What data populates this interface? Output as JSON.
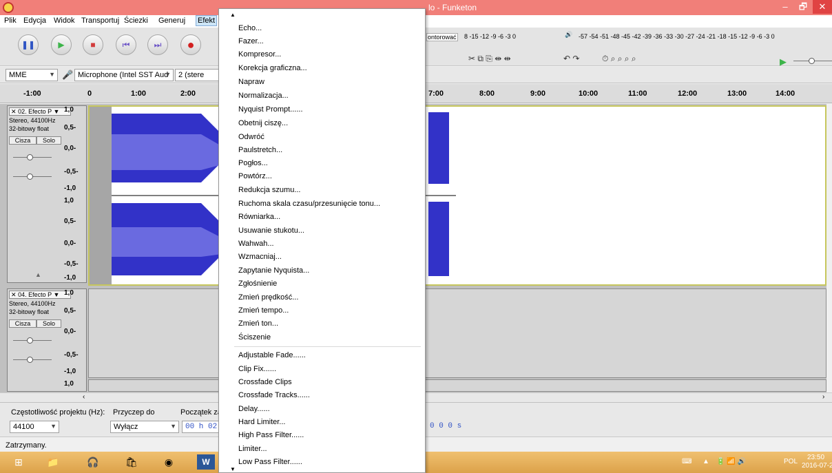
{
  "window": {
    "title": "lo - Funketon",
    "min_label": "–",
    "max_label": "🗗",
    "close_label": "✕"
  },
  "menubar": {
    "items": [
      "Plik",
      "Edycja",
      "Widok",
      "Transportuj",
      "Ściezki",
      "Generuj",
      "Efekt"
    ]
  },
  "toolbar": {
    "pause": "❚❚",
    "play": "▶",
    "stop": "■",
    "skip_start": "⏮",
    "skip_end": "⏭",
    "record": "●",
    "monitor_label": "ontorować",
    "rec_meter_scale": "8 -15 -12 -9 -6 -3 0",
    "play_meter_lr": "L\nP",
    "play_meter_scale": "-57 -54 -51 -48 -45 -42 -39 -36 -33 -30 -27 -24 -21 -18 -15 -12 -9 -6 -3 0",
    "edit_tools": "✂ ⧉ ⎘ ⇹ ⇹",
    "undo_redo": "↶ ↷",
    "zoom_tools": "⏱ ⌕ ⌕ ⌕ ⌕"
  },
  "devicebar": {
    "host": "MME",
    "input_device": "Microphone (Intel SST Aud",
    "channels": "2 (stere"
  },
  "ruler": {
    "ticks": [
      "-1:00",
      "0",
      "1:00",
      "2:00",
      "7:00",
      "8:00",
      "9:00",
      "10:00",
      "11:00",
      "12:00",
      "13:00",
      "14:00"
    ]
  },
  "tracks": [
    {
      "name": "02. Efecto P",
      "rate": "Stereo, 44100Hz",
      "format": "32-bitowy float",
      "mute": "Cisza",
      "solo": "Solo"
    },
    {
      "name": "04. Efecto P",
      "rate": "Stereo, 44100Hz",
      "format": "32-bitowy float",
      "mute": "Cisza",
      "solo": "Solo"
    }
  ],
  "scale": [
    "1,0",
    "0,5-",
    "0,0-",
    "-0,5-",
    "-1,0"
  ],
  "collapse_arrow": "▲",
  "bottombar": {
    "rate_label": "Częstotliwość projektu (Hz):",
    "rate_value": "44100",
    "snap_label": "Przyczep do",
    "snap_value": "Wyłącz",
    "start_label": "Początek za",
    "start_value": "00 h 02 r",
    "end_value": "0 0 0 s"
  },
  "status": {
    "text": "Zatrzymany."
  },
  "taskbar": {
    "time": "23:50",
    "date": "2016-07-21",
    "lang": "POL"
  },
  "effect_menu": {
    "items": [
      "Echo...",
      "Fazer...",
      "Kompresor...",
      "Korekcja graficzna...",
      "Napraw",
      "Normalizacja...",
      "Nyquist Prompt......",
      "Obetnij ciszę...",
      "Odwróć",
      "Paulstretch...",
      "Pogłos...",
      "Powtórz...",
      "Redukcja szumu...",
      "Ruchoma skala czasu/przesunięcie tonu...",
      "Równiarka...",
      "Usuwanie stukotu...",
      "Wahwah...",
      "Wzmacniaj...",
      "Zapytanie Nyquista...",
      "Zgłośnienie",
      "Zmień prędkość...",
      "Zmień tempo...",
      "Zmień ton...",
      "Ściszenie"
    ],
    "plugin_items": [
      "Adjustable Fade......",
      "Clip Fix......",
      "Crossfade Clips",
      "Crossfade Tracks......",
      "Delay......",
      "Hard Limiter...",
      "High Pass Filter......",
      "Limiter...",
      "Low Pass Filter......"
    ]
  }
}
